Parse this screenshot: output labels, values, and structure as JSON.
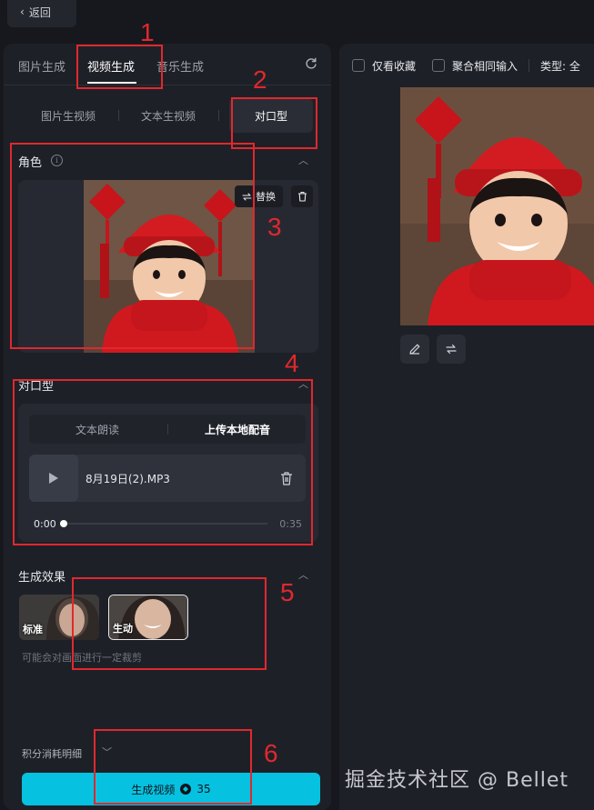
{
  "header": {
    "back_label": "返回"
  },
  "left_panel": {
    "tabs": [
      "图片生成",
      "视频生成",
      "音乐生成"
    ],
    "modes": [
      "图片生视频",
      "文本生视频",
      "对口型"
    ],
    "role": {
      "title": "角色",
      "replace_label": "替换"
    },
    "lip_sync": {
      "title": "对口型",
      "tabs": [
        "文本朗读",
        "上传本地配音"
      ],
      "file_name": "8月19日(2).MP3",
      "time_current": "0:00",
      "time_total": "0:35",
      "progress": 0.0
    },
    "effect": {
      "title": "生成效果",
      "options": [
        "标准",
        "生动"
      ],
      "selected": "生动",
      "note": "可能会对画面进行一定裁剪"
    },
    "cost": {
      "title": "积分消耗明细"
    },
    "generate": {
      "label": "生成视频",
      "points": "35"
    }
  },
  "right_panel": {
    "filters": {
      "favorites_only": "仅看收藏",
      "aggregate_same_input": "聚合相同输入",
      "type_label": "类型: 全"
    }
  },
  "annotations": [
    "1",
    "2",
    "3",
    "4",
    "5",
    "6"
  ],
  "watermark": "掘金技术社区 @ Bellet",
  "colors": {
    "accent": "#06c1e0",
    "annotation": "#e0282e",
    "panel": "#1e2027",
    "background": "#16181d"
  }
}
